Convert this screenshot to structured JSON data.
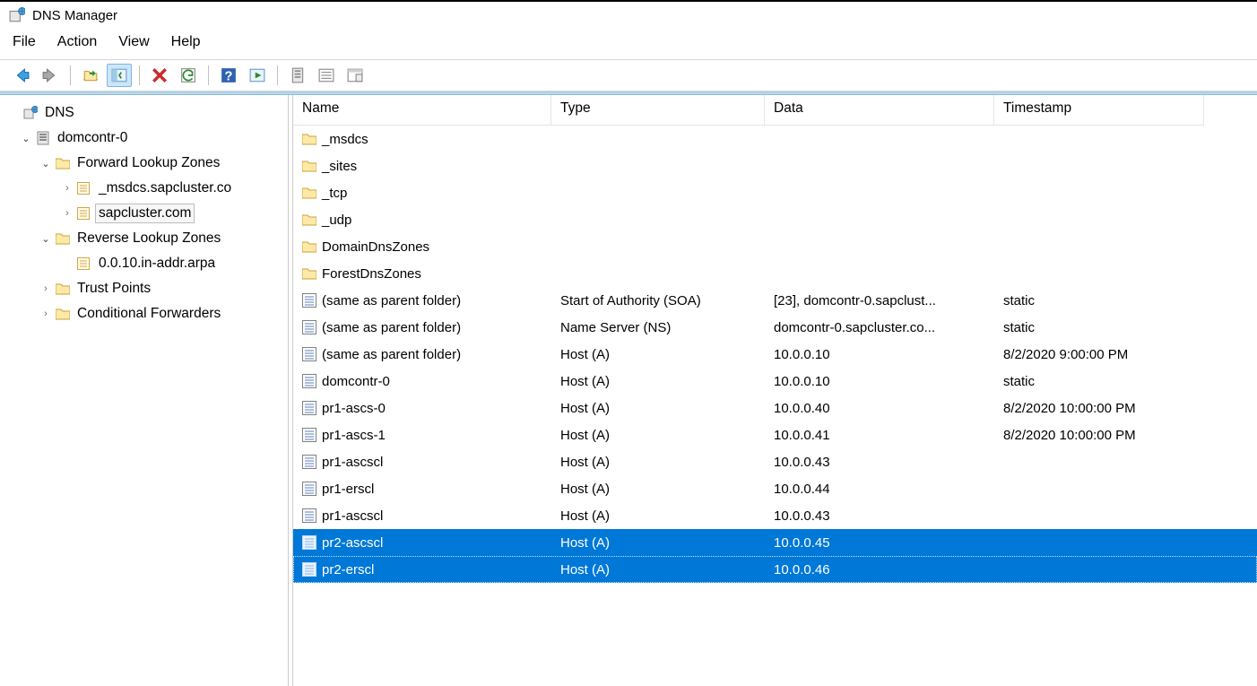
{
  "title": "DNS Manager",
  "menu": {
    "file": "File",
    "action": "Action",
    "view": "View",
    "help": "Help"
  },
  "toolbar": {
    "back": "back",
    "forward": "forward",
    "up": "up",
    "show_hide": "show-hide-console-tree",
    "delete": "delete",
    "refresh": "refresh",
    "help": "help",
    "preview": "preview",
    "new_server": "new-server",
    "properties": "properties",
    "filter": "filter"
  },
  "tree": {
    "root": "DNS",
    "server": "domcontr-0",
    "flz": "Forward Lookup Zones",
    "flz_children": [
      {
        "label": "_msdcs.sapcluster.co"
      },
      {
        "label": "sapcluster.com",
        "selected": true
      }
    ],
    "rlz": "Reverse Lookup Zones",
    "rlz_children": [
      {
        "label": "0.0.10.in-addr.arpa"
      }
    ],
    "tp": "Trust Points",
    "cf": "Conditional Forwarders"
  },
  "columns": {
    "name": "Name",
    "type": "Type",
    "data": "Data",
    "ts": "Timestamp"
  },
  "records": [
    {
      "icon": "folder",
      "name": "_msdcs",
      "type": "",
      "data": "",
      "ts": ""
    },
    {
      "icon": "folder",
      "name": "_sites",
      "type": "",
      "data": "",
      "ts": ""
    },
    {
      "icon": "folder",
      "name": "_tcp",
      "type": "",
      "data": "",
      "ts": ""
    },
    {
      "icon": "folder",
      "name": "_udp",
      "type": "",
      "data": "",
      "ts": ""
    },
    {
      "icon": "folder",
      "name": "DomainDnsZones",
      "type": "",
      "data": "",
      "ts": ""
    },
    {
      "icon": "folder",
      "name": "ForestDnsZones",
      "type": "",
      "data": "",
      "ts": ""
    },
    {
      "icon": "record",
      "name": "(same as parent folder)",
      "type": "Start of Authority (SOA)",
      "data": "[23], domcontr-0.sapclust...",
      "ts": "static"
    },
    {
      "icon": "record",
      "name": "(same as parent folder)",
      "type": "Name Server (NS)",
      "data": "domcontr-0.sapcluster.co...",
      "ts": "static"
    },
    {
      "icon": "record",
      "name": "(same as parent folder)",
      "type": "Host (A)",
      "data": "10.0.0.10",
      "ts": "8/2/2020 9:00:00 PM"
    },
    {
      "icon": "record",
      "name": "domcontr-0",
      "type": "Host (A)",
      "data": "10.0.0.10",
      "ts": "static"
    },
    {
      "icon": "record",
      "name": "pr1-ascs-0",
      "type": "Host (A)",
      "data": "10.0.0.40",
      "ts": "8/2/2020 10:00:00 PM"
    },
    {
      "icon": "record",
      "name": "pr1-ascs-1",
      "type": "Host (A)",
      "data": "10.0.0.41",
      "ts": "8/2/2020 10:00:00 PM"
    },
    {
      "icon": "record",
      "name": "pr1-ascscl",
      "type": "Host (A)",
      "data": "10.0.0.43",
      "ts": ""
    },
    {
      "icon": "record",
      "name": "pr1-erscl",
      "type": "Host (A)",
      "data": "10.0.0.44",
      "ts": ""
    },
    {
      "icon": "record",
      "name": "pr1-ascscl",
      "type": "Host (A)",
      "data": "10.0.0.43",
      "ts": ""
    },
    {
      "icon": "record",
      "name": "pr2-ascscl",
      "type": "Host (A)",
      "data": "10.0.0.45",
      "ts": "",
      "selected": true
    },
    {
      "icon": "record",
      "name": "pr2-erscl",
      "type": "Host (A)",
      "data": "10.0.0.46",
      "ts": "",
      "selected": true,
      "focus": true
    }
  ]
}
